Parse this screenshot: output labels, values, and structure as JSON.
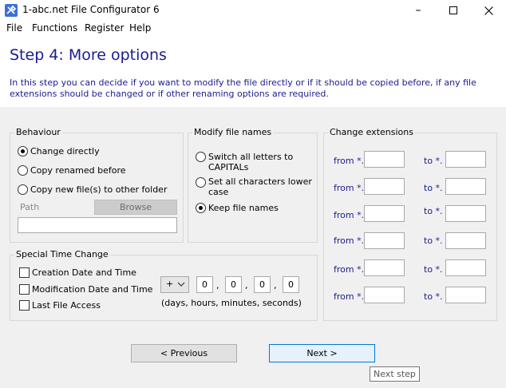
{
  "window": {
    "title": "1-abc.net File Configurator 6"
  },
  "menu": [
    "File",
    "Functions",
    "Register",
    "Help"
  ],
  "header": {
    "title": "Step 4: More options",
    "description": "In this step you can decide if you want to modify the file directly or if it should be copied before, if any file extensions should be changed or if other renaming options are required."
  },
  "behaviour": {
    "title": "Behaviour",
    "options": [
      "Change directly",
      "Copy renamed before",
      "Copy new file(s) to other folder"
    ],
    "selected_index": 0,
    "path_label": "Path",
    "browse_label": "Browse",
    "path_value": ""
  },
  "modify": {
    "title": "Modify file names",
    "options": [
      "Switch all letters to CAPITALs",
      "Set all characters lower case",
      "Keep file names"
    ],
    "selected_index": 2
  },
  "extensions": {
    "title": "Change extensions",
    "from_label": "from *.",
    "to_label": "to *.",
    "rows": [
      {
        "from": "",
        "to": ""
      },
      {
        "from": "",
        "to": ""
      },
      {
        "from": "",
        "to": ""
      },
      {
        "from": "",
        "to": ""
      },
      {
        "from": "",
        "to": ""
      },
      {
        "from": "",
        "to": ""
      }
    ]
  },
  "time_change": {
    "title": "Special Time Change",
    "checkboxes": [
      "Creation Date and Time",
      "Modification Date and Time",
      "Last File Access"
    ],
    "sign": "+",
    "values": [
      "0",
      "0",
      "0",
      "0"
    ],
    "separator": ",",
    "units_label": "(days, hours, minutes, seconds)"
  },
  "nav": {
    "previous_label": "< Previous",
    "next_label": "Next >",
    "tooltip": "Next step"
  },
  "colors": {
    "header_text": "#1b1b8f",
    "accent_border": "#0078d7",
    "dialog_bg": "#f0f0f0"
  }
}
